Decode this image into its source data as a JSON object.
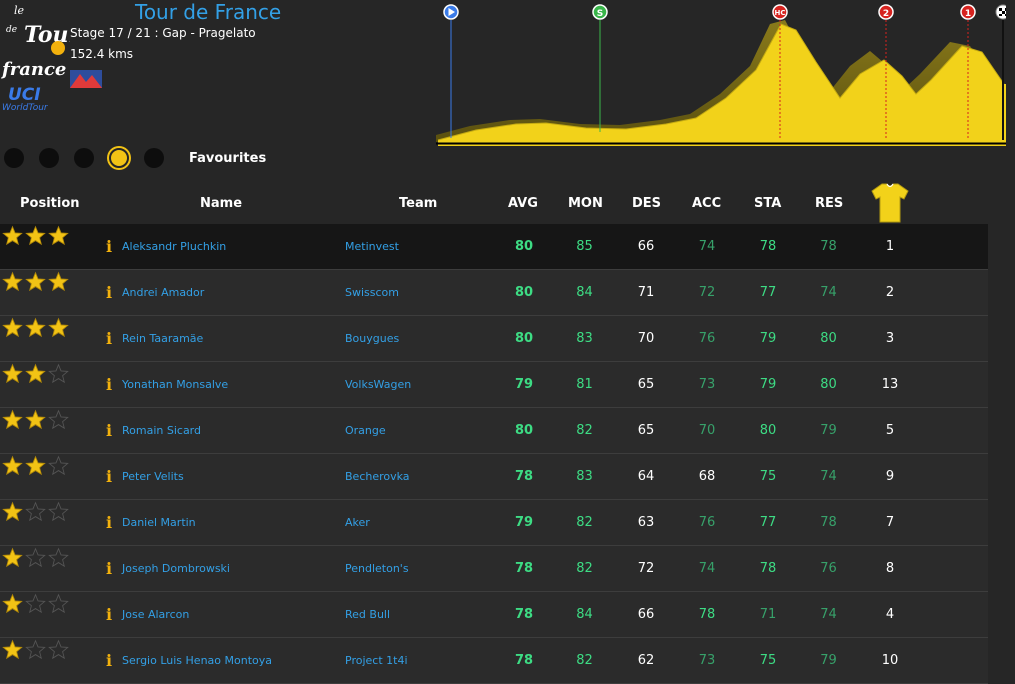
{
  "logo": {
    "tdf_text": "le Tour de France",
    "uci_text": "UCI WorldTour"
  },
  "race": {
    "title": "Tour de France",
    "stage_line": "Stage 17 / 21 : Gap - Pragelato",
    "distance": "152.4 kms"
  },
  "profile": {
    "markers": [
      {
        "label": "▶",
        "color": "#3a7be8",
        "line_color": "#3a7be8"
      },
      {
        "label": "S",
        "color": "#39b54a",
        "line_color": "#39b54a"
      },
      {
        "label": "HC",
        "color": "#d6231f",
        "line_color": "#d6231f"
      },
      {
        "label": "2",
        "color": "#d6231f",
        "line_color": "#d6231f"
      },
      {
        "label": "1",
        "color": "#d6231f",
        "line_color": "#d6231f"
      }
    ]
  },
  "tabs": {
    "count": 5,
    "active_index": 3,
    "label": "Favourites"
  },
  "columns": {
    "position": "Position",
    "name": "Name",
    "team": "Team",
    "avg": "AVG",
    "mon": "MON",
    "des": "DES",
    "acc": "ACC",
    "sta": "STA",
    "res": "RES"
  },
  "colors": {
    "accent_blue": "#33a0e6",
    "yellow": "#f2c315",
    "stat_green": "#3ddc84",
    "stat_dim_green": "#37a16a"
  },
  "riders": [
    {
      "stars": 3,
      "name": "Aleksandr Pluchkin",
      "team": "Metinvest",
      "avg": "80",
      "mon": "85",
      "des": "66",
      "acc": "74",
      "sta": "78",
      "res": "78",
      "rank": "1"
    },
    {
      "stars": 3,
      "name": "Andrei Amador",
      "team": "Swisscom",
      "avg": "80",
      "mon": "84",
      "des": "71",
      "acc": "72",
      "sta": "77",
      "res": "74",
      "rank": "2"
    },
    {
      "stars": 3,
      "name": "Rein Taaramäe",
      "team": "Bouygues",
      "avg": "80",
      "mon": "83",
      "des": "70",
      "acc": "76",
      "sta": "79",
      "res": "80",
      "rank": "3"
    },
    {
      "stars": 2,
      "name": "Yonathan Monsalve",
      "team": "VolksWagen",
      "avg": "79",
      "mon": "81",
      "des": "65",
      "acc": "73",
      "sta": "79",
      "res": "80",
      "rank": "13"
    },
    {
      "stars": 2,
      "name": "Romain Sicard",
      "team": "Orange",
      "avg": "80",
      "mon": "82",
      "des": "65",
      "acc": "70",
      "sta": "80",
      "res": "79",
      "rank": "5"
    },
    {
      "stars": 2,
      "name": "Peter Velits",
      "team": "Becherovka",
      "avg": "78",
      "mon": "83",
      "des": "64",
      "acc": "68",
      "sta": "75",
      "res": "74",
      "rank": "9"
    },
    {
      "stars": 1,
      "name": "Daniel Martin",
      "team": "Aker",
      "avg": "79",
      "mon": "82",
      "des": "63",
      "acc": "76",
      "sta": "77",
      "res": "78",
      "rank": "7"
    },
    {
      "stars": 1,
      "name": "Joseph Dombrowski",
      "team": "Pendleton's",
      "avg": "78",
      "mon": "82",
      "des": "72",
      "acc": "74",
      "sta": "78",
      "res": "76",
      "rank": "8"
    },
    {
      "stars": 1,
      "name": "Jose Alarcon",
      "team": "Red Bull",
      "avg": "78",
      "mon": "84",
      "des": "66",
      "acc": "78",
      "sta": "71",
      "res": "74",
      "rank": "4"
    },
    {
      "stars": 1,
      "name": "Sergio Luis Henao Montoya",
      "team": "Project 1t4i",
      "avg": "78",
      "mon": "82",
      "des": "62",
      "acc": "73",
      "sta": "75",
      "res": "79",
      "rank": "10"
    }
  ]
}
